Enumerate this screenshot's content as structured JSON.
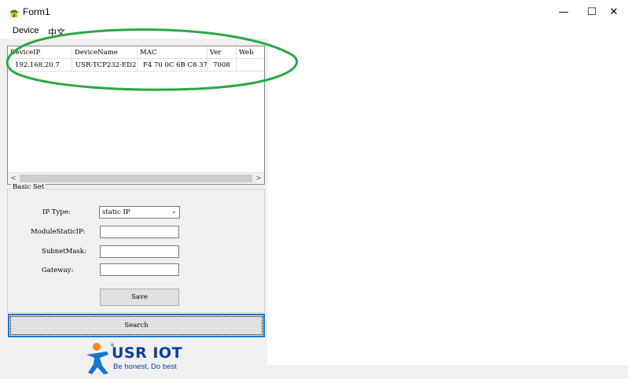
{
  "window": {
    "title": "Form1",
    "minimize": "—",
    "maximize": "☐",
    "close": "✕"
  },
  "menu": {
    "items": [
      "Device",
      "中文"
    ]
  },
  "device_table": {
    "columns": [
      "DeviceIP",
      "DeviceName",
      "MAC",
      "Ver",
      "Web"
    ],
    "rows": [
      [
        "192.168.20.7",
        "USR-TCP232-ED2",
        "F4 70 0C 6B C8 37",
        "7008",
        ""
      ]
    ]
  },
  "basic_set": {
    "title": "Basic Set",
    "ip_type_label": "IP Type:",
    "ip_type_value": "static IP",
    "module_ip_label": "ModuleStaticIP:",
    "module_ip_value": "",
    "subnet_label": "SubnetMask:",
    "subnet_value": "",
    "gateway_label": "Gateway:",
    "gateway_value": "",
    "save_label": "Save"
  },
  "search_label": "Search",
  "logo": {
    "name": "USR IOT",
    "tagline": "Be honest, Do best",
    "registered": "®"
  },
  "colors": {
    "annotation": "#2aa745",
    "logo_blue": "#0b3f9b",
    "logo_orange": "#f08a1c"
  }
}
